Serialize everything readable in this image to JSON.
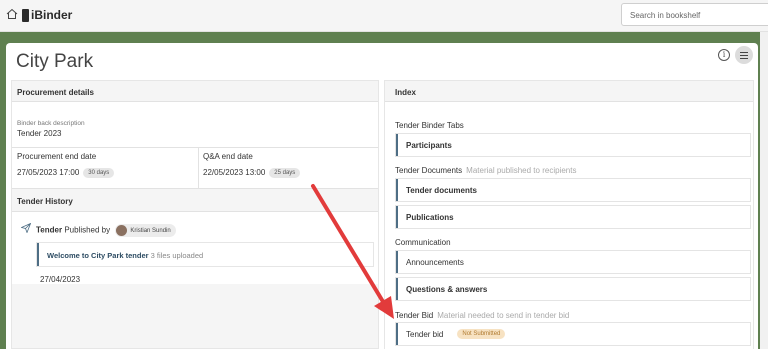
{
  "topbar": {
    "logo_text": "iBinder",
    "search_placeholder": "Search in bookshelf"
  },
  "binder": {
    "title": "City Park"
  },
  "procurement": {
    "heading": "Procurement details",
    "back_desc_label": "Binder back description",
    "back_desc_value": "Tender 2023",
    "end_date_label": "Procurement end date",
    "end_date_value": "27/05/2023 17:00",
    "end_date_badge": "30 days",
    "qa_label": "Q&A end date",
    "qa_value": "22/05/2023 13:00",
    "qa_badge": "25 days"
  },
  "history": {
    "heading": "Tender History",
    "entry_name": "Tender",
    "entry_published": "Published by",
    "entry_person": "Kristian Sundin",
    "message_title": "Welcome to City Park tender",
    "message_files": "3 files uploaded",
    "entry_date": "27/04/2023"
  },
  "index": {
    "heading": "Index",
    "group1": "Tender Binder Tabs",
    "participants": "Participants",
    "group2": "Tender Documents",
    "group2_note": "Material published to recipients",
    "tender_documents": "Tender documents",
    "publications": "Publications",
    "group3": "Communication",
    "announcements": "Announcements",
    "qa": "Questions & answers",
    "group4": "Tender Bid",
    "group4_note": "Material needed to send in tender bid",
    "tender_bid": "Tender bid",
    "tender_bid_status": "Not Submitted"
  },
  "colors": {
    "background_green": "#5f8050",
    "accent_bar": "#4e6e85",
    "annotation_arrow": "#e23b3b",
    "status_pill": "#f7e2c2"
  }
}
